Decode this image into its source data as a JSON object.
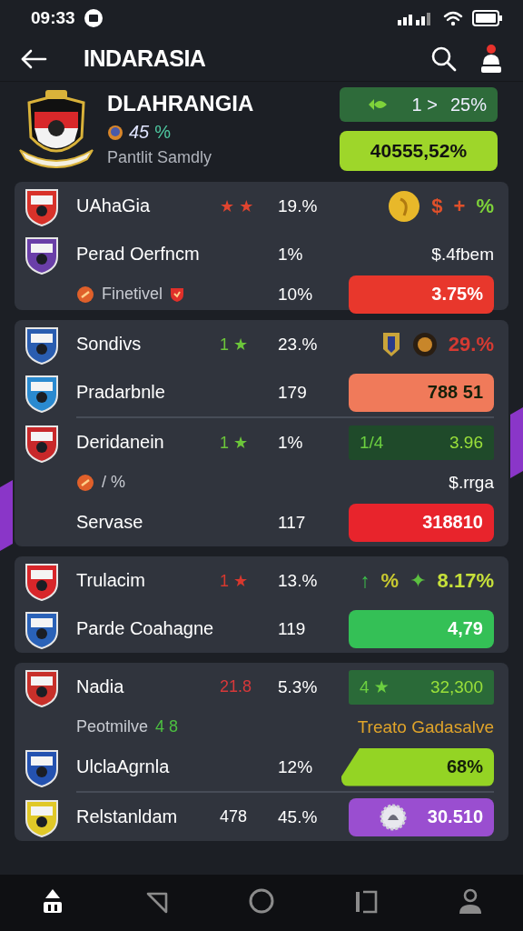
{
  "status_bar": {
    "time": "09:33"
  },
  "app_bar": {
    "title": "INDARASIA"
  },
  "header": {
    "name": "DLAHRANGIA",
    "stat": "45",
    "stat_suffix": "%",
    "subtitle": "Pantlit Samdly",
    "pills": [
      {
        "kind": "box",
        "color": "#2e6b3a",
        "parts": [
          "1 >",
          "25%"
        ]
      },
      {
        "kind": "pill",
        "color": "#9ed62a",
        "text": "40555,52%"
      }
    ]
  },
  "cards": [
    {
      "rows": [
        {
          "kind": "team",
          "color": "#d8322a",
          "name": "UAhaGia",
          "mark": {
            "text": "★ ★",
            "color": "#e0442f"
          },
          "value": "19.%",
          "right": {
            "kind": "tokens",
            "tokens": [
              {
                "kind": "coin"
              },
              {
                "kind": "text",
                "text": "$",
                "color": "#e0502a"
              },
              {
                "kind": "text",
                "text": "+",
                "color": "#e0502a"
              },
              {
                "kind": "text",
                "text": "%",
                "color": "#7ed23a"
              }
            ]
          }
        },
        {
          "kind": "team",
          "color": "#6a3fa8",
          "name": "Perad Oerfncm",
          "value": "1%",
          "right": {
            "kind": "text",
            "text": "$.4fbem",
            "color": "#ffffff"
          }
        },
        {
          "kind": "sub",
          "name": "Finetivel",
          "value": "10%",
          "right": {
            "kind": "pill",
            "color": "#e8372c",
            "text": "3.75%"
          }
        }
      ]
    },
    {
      "rows": [
        {
          "kind": "team",
          "color": "#2a5db0",
          "name": "Sondivs",
          "mark": {
            "text": "1 ★",
            "color": "#6cc63a"
          },
          "value": "23.%",
          "right": {
            "kind": "tokens",
            "tokens": [
              {
                "kind": "badge"
              },
              {
                "kind": "seal"
              },
              {
                "kind": "text",
                "text": "29.%",
                "color": "#d63a32"
              }
            ]
          }
        },
        {
          "kind": "team",
          "color": "#2a8ad0",
          "name": "Pradarbnle",
          "value": "179",
          "divider": true,
          "right": {
            "kind": "pill",
            "color": "#f07a5a",
            "text": "788 51"
          }
        },
        {
          "kind": "team",
          "color": "#c8282a",
          "name": "Deridanein",
          "mark": {
            "text": "1 ★",
            "color": "#6cc63a"
          },
          "value": "1%",
          "right": {
            "kind": "box",
            "color": "#1f4a2a",
            "parts": [
              "1/4",
              "3.96"
            ]
          }
        },
        {
          "kind": "sub",
          "name": "/ %",
          "right": {
            "kind": "text",
            "text": "$.rrga",
            "color": "#ffffff"
          }
        },
        {
          "kind": "plain",
          "name": "Servase",
          "value": "117",
          "right": {
            "kind": "pill",
            "color": "#e8242c",
            "text": "318810"
          }
        }
      ]
    },
    {
      "rows": [
        {
          "kind": "team",
          "color": "#d8262a",
          "name": "Trulacim",
          "mark": {
            "text": "1 ★",
            "color": "#d8382e"
          },
          "value": "13.%",
          "right": {
            "kind": "tokens",
            "tokens": [
              {
                "kind": "text",
                "text": "↑",
                "color": "#3cc04a"
              },
              {
                "kind": "text",
                "text": "%",
                "color": "#c8c830"
              },
              {
                "kind": "text",
                "text": "✦",
                "color": "#5cc040"
              },
              {
                "kind": "text",
                "text": "8.17%",
                "color": "#c6e03a"
              }
            ]
          }
        },
        {
          "kind": "team",
          "color": "#2a62b8",
          "name": "Parde Coahagne",
          "value": "119",
          "right": {
            "kind": "pill",
            "color": "#34c056",
            "text": "4,79"
          }
        }
      ]
    },
    {
      "rows": [
        {
          "kind": "team",
          "color": "#c8302a",
          "name": "Nadia",
          "mark": {
            "text": "21.8",
            "color": "#d8383a"
          },
          "value": "5.3%",
          "right": {
            "kind": "box",
            "color": "#2a6a38",
            "parts": [
              "4 ★",
              "32,300"
            ]
          }
        },
        {
          "kind": "note",
          "name": "Peotmilve",
          "extra": "4 8",
          "right": {
            "kind": "text",
            "text": "Treato Gadasalve",
            "color": "#e0a42a"
          }
        },
        {
          "kind": "team",
          "color": "#2452b0",
          "name": "UlclaAgrnla",
          "value": "12%",
          "divider": true,
          "right": {
            "kind": "slant",
            "color": "#94d424",
            "text": "68%"
          }
        },
        {
          "kind": "team",
          "color": "#e0c828",
          "name": "Relstanldam",
          "mark": {
            "text": "478",
            "color": "#ffffff"
          },
          "value": "45.%",
          "right": {
            "kind": "icon-pill",
            "color": "#9a4ed0",
            "text": "30.510"
          }
        }
      ]
    }
  ],
  "nav": [
    {
      "kind": "home",
      "selected": true
    },
    {
      "kind": "back",
      "selected": false
    },
    {
      "kind": "circle",
      "selected": false
    },
    {
      "kind": "recent",
      "selected": false
    },
    {
      "kind": "profile",
      "selected": false
    }
  ]
}
